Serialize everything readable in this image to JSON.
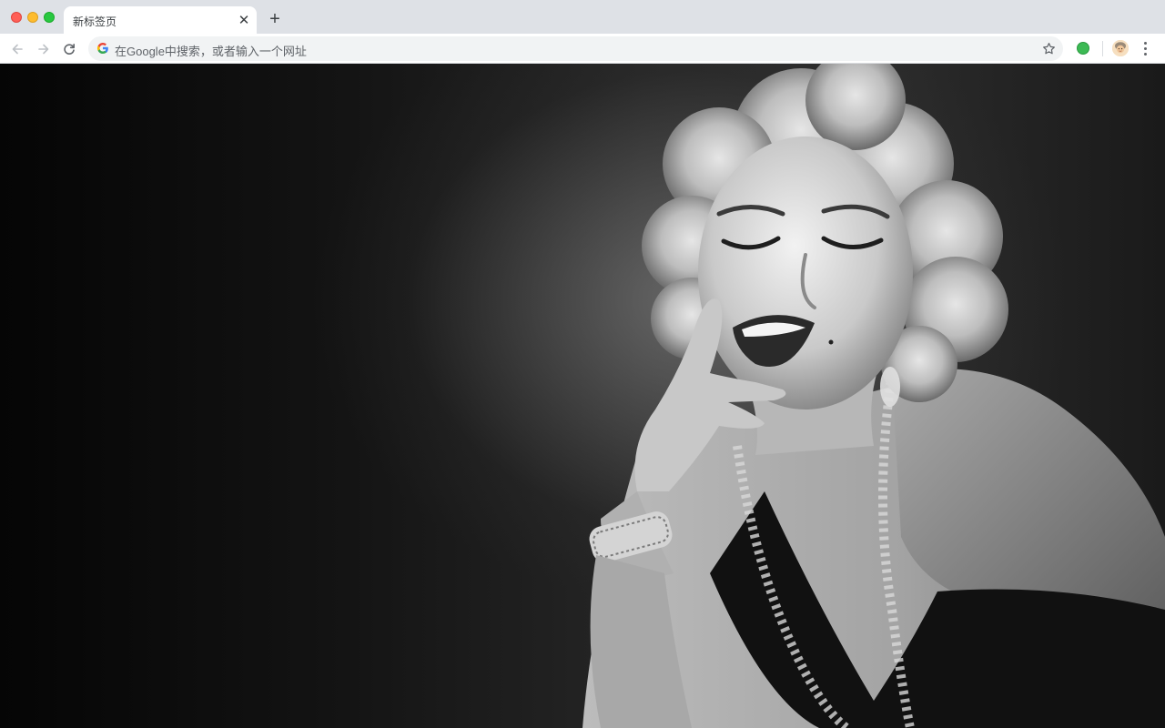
{
  "browser": {
    "tab": {
      "title": "新标签页"
    },
    "omnibox": {
      "placeholder": "在Google中搜索，或者输入一个网址"
    }
  },
  "icons": {
    "back": "arrow-left-icon",
    "forward": "arrow-right-icon",
    "reload": "reload-icon",
    "search_engine": "google-g-icon",
    "bookmark": "star-icon",
    "extension": "green-circle-extension-icon",
    "profile": "avatar-icon",
    "menu": "three-dots-icon",
    "tab_close": "close-icon",
    "new_tab": "plus-icon"
  },
  "colors": {
    "tabstrip": "#dee1e6",
    "toolbar": "#ffffff",
    "omnibox": "#f1f3f4",
    "text": "#3c4043",
    "muted_text": "#5f6368",
    "traffic_red": "#ff5f57",
    "traffic_yellow": "#febc2e",
    "traffic_green": "#28c840",
    "extension_green": "#3cba54"
  },
  "content": {
    "type": "new-tab-wallpaper",
    "wallpaper": "black-and-white portrait photo of a laughing woman with curly blonde hair"
  }
}
